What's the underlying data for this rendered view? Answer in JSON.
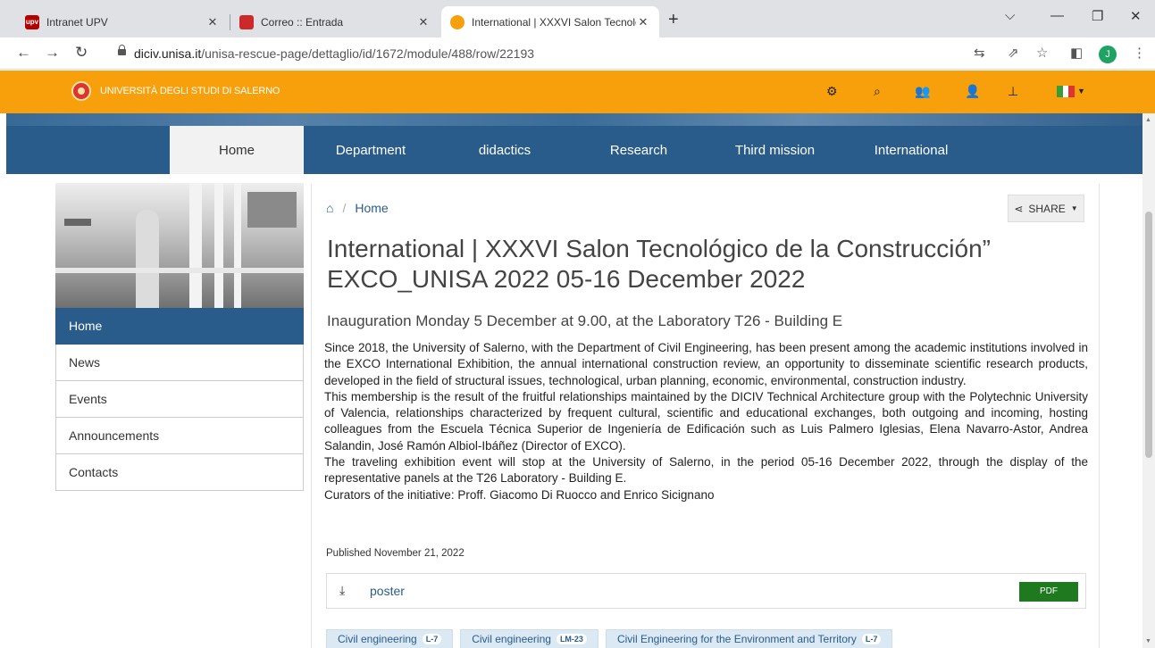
{
  "browser": {
    "tabs": [
      {
        "title": "Intranet UPV",
        "favicon_text": "upv",
        "favicon_color": "#b30000"
      },
      {
        "title": "Correo :: Entrada",
        "favicon_text": "",
        "favicon_color": "#cc2a2a"
      },
      {
        "title": "International | XXXVI Salon Tecnológico",
        "favicon_text": "",
        "favicon_color": "#f7a00c",
        "active": true
      }
    ],
    "url_host": "diciv.unisa.it",
    "url_path": "/unisa-rescue-page/dettaglio/id/1672/module/488/row/22193",
    "profile_initial": "J"
  },
  "site": {
    "name": "UNIVERSITÀ DEGLI STUDI DI SALERNO",
    "accent_color": "#f7a00c",
    "primary_color": "#2a5c8b"
  },
  "nav": {
    "items": [
      "Home",
      "Department",
      "didactics",
      "Research",
      "Third mission",
      "International"
    ]
  },
  "sidebar": {
    "items": [
      "Home",
      "News",
      "Events",
      "Announcements",
      "Contacts"
    ]
  },
  "article": {
    "breadcrumb": "Home",
    "share_label": "SHARE",
    "title": "International | XXXVI Salon Tecnológico de la Construcción” EXCO_UNISA 2022 05-16 December 2022",
    "subtitle": "Inauguration Monday 5 December at 9.00, at the Laboratory T26 - Building E",
    "paragraphs": [
      "Since 2018, the University of Salerno, with the Department of Civil Engineering, has been present among the academic institutions involved in the EXCO International Exhibition, the annual international construction review, an opportunity to disseminate scientific research products, developed in the field of structural issues, technological, urban planning, economic, environmental, construction industry.",
      "This membership is the result of the fruitful relationships maintained by the DICIV Technical Architecture group with the Polytechnic University of Valencia, relationships characterized by frequent cultural, scientific and educational exchanges, both outgoing and incoming, hosting colleagues from the Escuela Técnica Superior de Ingeniería de Edificación such as Luis Palmero Iglesias, Elena Navarro-Astor, Andrea Salandin, José Ramón Albiol-Ibáñez (Director of EXCO).",
      "The traveling exhibition event will stop at the University of Salerno, in the period 05-16 December 2022, through the display of the representative panels at the T26 Laboratory - Building E.",
      "Curators of the initiative: Proff. Giacomo Di Ruocco and Enrico Sicignano"
    ],
    "published": "Published November 21, 2022",
    "attachment": {
      "name": "poster",
      "button": "PDF"
    },
    "tags": [
      {
        "label": "Civil engineering",
        "badge": "L-7"
      },
      {
        "label": "Civil engineering",
        "badge": "LM-23"
      },
      {
        "label": "Civil Engineering for the Environment and Territory",
        "badge": "L-7"
      }
    ]
  }
}
